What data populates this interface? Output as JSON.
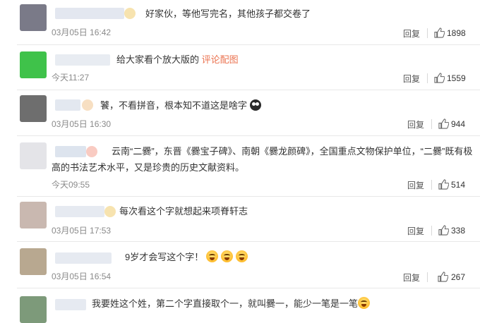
{
  "actions": {
    "reply_label": "回复"
  },
  "comments": [
    {
      "text": "好家伙，等他写完名，其他孩子都交卷了",
      "time": "03月05日 16:42",
      "likes": "1898",
      "avatar_color": "#7a7a88",
      "name_color": "#e3e7f0"
    },
    {
      "text": "给大家看个放大版的",
      "link": "评论配图",
      "time": "今天11:27",
      "likes": "1559",
      "avatar_color": "#3fc24a",
      "name_color": "#e8ecf2"
    },
    {
      "text": "饕，不看拼音，根本知不道这是啥字",
      "time": "03月05日 16:30",
      "likes": "944",
      "avatar_color": "#6e6e6e",
      "name_color": "#e3e8f0"
    },
    {
      "text": "云南“二爨”，东晋《爨宝子碑》、南朝《爨龙颜碑》，全国重点文物保护单位，“二爨”既有极",
      "text2": "高的书法艺术水平，又是珍贵的历史文献资料。",
      "time": "今天09:55",
      "likes": "514",
      "avatar_color": "#e4e4e8",
      "name_color": "#dde4ee"
    },
    {
      "text": "每次看这个字就想起来项脊轩志",
      "time": "03月05日 17:53",
      "likes": "338",
      "avatar_color": "#c9b8b0",
      "name_color": "#e6eaf1"
    },
    {
      "text": "9岁才会写这个字！",
      "time": "03月05日 16:54",
      "likes": "267",
      "avatar_color": "#b8a890",
      "name_color": "#e6eaf1"
    },
    {
      "text": "我要姓这个姓，第二个字直接取个一，就叫爨一，能少一笔是一笔",
      "avatar_color": "#7d9a7a",
      "name_color": "#e6eaf1"
    }
  ]
}
